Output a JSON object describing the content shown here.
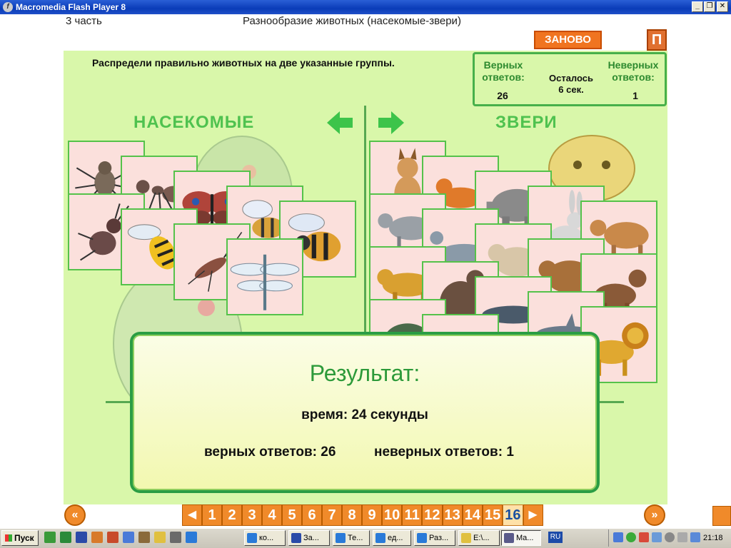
{
  "window": {
    "title": "Macromedia Flash Player 8",
    "minimize": "_",
    "restore": "❐",
    "close": "✕"
  },
  "header": {
    "part": "3 часть",
    "lesson_title": "Разнообразие животных (насекомые-звери)",
    "restart_label": "ЗАНОВО",
    "p_label": "П"
  },
  "instruction": "Распредели правильно животных на две указанные группы.",
  "score": {
    "correct_label_1": "Верных",
    "correct_label_2": "ответов:",
    "correct_value": "26",
    "remain_1": "Осталось",
    "remain_2": "6 сек.",
    "wrong_label_1": "Неверных",
    "wrong_label_2": "ответов:",
    "wrong_value": "1"
  },
  "groups": {
    "insects": "НАСЕКОМЫЕ",
    "beasts": "ЗВЕРИ"
  },
  "insect_cards": [
    "spider",
    "ant",
    "butterfly",
    "stag-beetle",
    "wasp",
    "bee",
    "longhorn-beetle",
    "bumblebee",
    "dragonfly"
  ],
  "beast_cards": [
    "lynx",
    "fox",
    "elephant",
    "hare",
    "cow",
    "goat",
    "seal",
    "hamster",
    "lion",
    "beaver",
    "whale",
    "dog",
    "hedgehog",
    "dolphin",
    "lion2"
  ],
  "result": {
    "title": "Результат:",
    "time": "время: 24 секунды",
    "correct": "верных ответов: 26",
    "wrong": "неверных ответов: 1"
  },
  "nav": {
    "prev_symbol": "«",
    "next_symbol": "»",
    "left_arrow": "◀",
    "right_arrow": "▶",
    "pages": [
      "1",
      "2",
      "3",
      "4",
      "5",
      "6",
      "7",
      "8",
      "9",
      "10",
      "11",
      "12",
      "13",
      "14",
      "15",
      "16"
    ],
    "active_page": "16"
  },
  "taskbar": {
    "start": "Пуск",
    "tasks": [
      "ко...",
      "За...",
      "Те...",
      "ед...",
      "Раз...",
      "E:\\...",
      "Ma..."
    ],
    "lang": "RU",
    "clock": "21:18"
  },
  "colors": {
    "panel": "#d9f7aa",
    "accent_green": "#4fc24f",
    "orange": "#f08a2a",
    "result_border": "#2a9d44"
  }
}
